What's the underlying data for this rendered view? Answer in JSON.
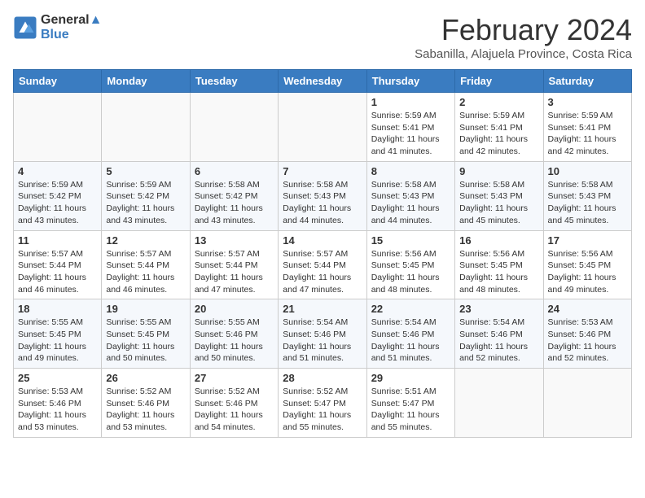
{
  "logo": {
    "line1": "General",
    "line2": "Blue"
  },
  "title": "February 2024",
  "subtitle": "Sabanilla, Alajuela Province, Costa Rica",
  "weekdays": [
    "Sunday",
    "Monday",
    "Tuesday",
    "Wednesday",
    "Thursday",
    "Friday",
    "Saturday"
  ],
  "weeks": [
    [
      {
        "day": "",
        "info": ""
      },
      {
        "day": "",
        "info": ""
      },
      {
        "day": "",
        "info": ""
      },
      {
        "day": "",
        "info": ""
      },
      {
        "day": "1",
        "info": "Sunrise: 5:59 AM\nSunset: 5:41 PM\nDaylight: 11 hours\nand 41 minutes."
      },
      {
        "day": "2",
        "info": "Sunrise: 5:59 AM\nSunset: 5:41 PM\nDaylight: 11 hours\nand 42 minutes."
      },
      {
        "day": "3",
        "info": "Sunrise: 5:59 AM\nSunset: 5:41 PM\nDaylight: 11 hours\nand 42 minutes."
      }
    ],
    [
      {
        "day": "4",
        "info": "Sunrise: 5:59 AM\nSunset: 5:42 PM\nDaylight: 11 hours\nand 43 minutes."
      },
      {
        "day": "5",
        "info": "Sunrise: 5:59 AM\nSunset: 5:42 PM\nDaylight: 11 hours\nand 43 minutes."
      },
      {
        "day": "6",
        "info": "Sunrise: 5:58 AM\nSunset: 5:42 PM\nDaylight: 11 hours\nand 43 minutes."
      },
      {
        "day": "7",
        "info": "Sunrise: 5:58 AM\nSunset: 5:43 PM\nDaylight: 11 hours\nand 44 minutes."
      },
      {
        "day": "8",
        "info": "Sunrise: 5:58 AM\nSunset: 5:43 PM\nDaylight: 11 hours\nand 44 minutes."
      },
      {
        "day": "9",
        "info": "Sunrise: 5:58 AM\nSunset: 5:43 PM\nDaylight: 11 hours\nand 45 minutes."
      },
      {
        "day": "10",
        "info": "Sunrise: 5:58 AM\nSunset: 5:43 PM\nDaylight: 11 hours\nand 45 minutes."
      }
    ],
    [
      {
        "day": "11",
        "info": "Sunrise: 5:57 AM\nSunset: 5:44 PM\nDaylight: 11 hours\nand 46 minutes."
      },
      {
        "day": "12",
        "info": "Sunrise: 5:57 AM\nSunset: 5:44 PM\nDaylight: 11 hours\nand 46 minutes."
      },
      {
        "day": "13",
        "info": "Sunrise: 5:57 AM\nSunset: 5:44 PM\nDaylight: 11 hours\nand 47 minutes."
      },
      {
        "day": "14",
        "info": "Sunrise: 5:57 AM\nSunset: 5:44 PM\nDaylight: 11 hours\nand 47 minutes."
      },
      {
        "day": "15",
        "info": "Sunrise: 5:56 AM\nSunset: 5:45 PM\nDaylight: 11 hours\nand 48 minutes."
      },
      {
        "day": "16",
        "info": "Sunrise: 5:56 AM\nSunset: 5:45 PM\nDaylight: 11 hours\nand 48 minutes."
      },
      {
        "day": "17",
        "info": "Sunrise: 5:56 AM\nSunset: 5:45 PM\nDaylight: 11 hours\nand 49 minutes."
      }
    ],
    [
      {
        "day": "18",
        "info": "Sunrise: 5:55 AM\nSunset: 5:45 PM\nDaylight: 11 hours\nand 49 minutes."
      },
      {
        "day": "19",
        "info": "Sunrise: 5:55 AM\nSunset: 5:45 PM\nDaylight: 11 hours\nand 50 minutes."
      },
      {
        "day": "20",
        "info": "Sunrise: 5:55 AM\nSunset: 5:46 PM\nDaylight: 11 hours\nand 50 minutes."
      },
      {
        "day": "21",
        "info": "Sunrise: 5:54 AM\nSunset: 5:46 PM\nDaylight: 11 hours\nand 51 minutes."
      },
      {
        "day": "22",
        "info": "Sunrise: 5:54 AM\nSunset: 5:46 PM\nDaylight: 11 hours\nand 51 minutes."
      },
      {
        "day": "23",
        "info": "Sunrise: 5:54 AM\nSunset: 5:46 PM\nDaylight: 11 hours\nand 52 minutes."
      },
      {
        "day": "24",
        "info": "Sunrise: 5:53 AM\nSunset: 5:46 PM\nDaylight: 11 hours\nand 52 minutes."
      }
    ],
    [
      {
        "day": "25",
        "info": "Sunrise: 5:53 AM\nSunset: 5:46 PM\nDaylight: 11 hours\nand 53 minutes."
      },
      {
        "day": "26",
        "info": "Sunrise: 5:52 AM\nSunset: 5:46 PM\nDaylight: 11 hours\nand 53 minutes."
      },
      {
        "day": "27",
        "info": "Sunrise: 5:52 AM\nSunset: 5:46 PM\nDaylight: 11 hours\nand 54 minutes."
      },
      {
        "day": "28",
        "info": "Sunrise: 5:52 AM\nSunset: 5:47 PM\nDaylight: 11 hours\nand 55 minutes."
      },
      {
        "day": "29",
        "info": "Sunrise: 5:51 AM\nSunset: 5:47 PM\nDaylight: 11 hours\nand 55 minutes."
      },
      {
        "day": "",
        "info": ""
      },
      {
        "day": "",
        "info": ""
      }
    ]
  ]
}
